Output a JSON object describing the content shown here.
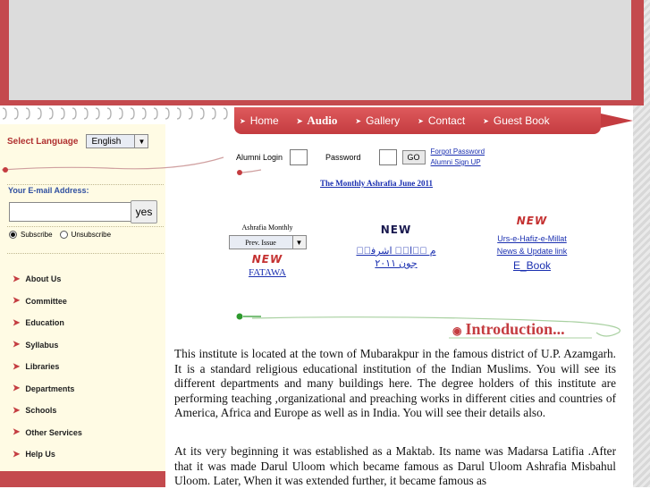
{
  "nav": {
    "items": [
      {
        "label": "Home",
        "bold": false
      },
      {
        "label": "Audio",
        "bold": true
      },
      {
        "label": "Gallery",
        "bold": false
      },
      {
        "label": "Contact",
        "bold": false
      },
      {
        "label": "Guest Book",
        "bold": false
      }
    ]
  },
  "language": {
    "label": "Select Language",
    "selected": "English"
  },
  "alumni": {
    "login_label": "Alumni Login",
    "password_label": "Password",
    "go_label": "GO",
    "forgot_password": "Forgot Password",
    "signup": "Alumni Sign UP"
  },
  "monthly_link": "The Monthly Ashrafia June 2011",
  "email": {
    "label": "Your E-mail Address:",
    "yes_label": "yes",
    "subscribe": "Subscribe",
    "unsubscribe": "Unsubscribe"
  },
  "menu": {
    "items": [
      "About Us",
      "Committee",
      "Education",
      "Syllabus",
      "Libraries",
      "Departments",
      "Schools",
      "Other Services",
      "Help Us"
    ]
  },
  "ashrafia": {
    "title": "Ashrafia Monthly",
    "select_value": "Prev. Issue",
    "new_badge": "NEW",
    "fatawa": "FATAWA"
  },
  "urdu": {
    "new_badge": "NEW",
    "line1": "م ٰ⃞ام⃞ اشرفی⃞",
    "line2": "جون ۲۰۱۱"
  },
  "urs": {
    "new_badge": "NEW",
    "line1": "Urs-e-Hafiz-e-Millat",
    "line2": "News & Update link",
    "ebook": "E_Book"
  },
  "intro": {
    "title": "Introduction...",
    "paragraph1": "This institute is located at the town of Mubarakpur in the famous district of U.P. Azamgarh. It is a standard religious educational institution of the  Indian Muslims. You will see its different departments and many buildings here. The degree holders of this institute are performing teaching ,organizational and preaching works in different cities and countries of America, Africa and Europe as well as in India. You will see their details also.",
    "paragraph2": "At its very beginning it was established as a Maktab. Its name was Madarsa Latifia .After that it was made Darul Uloom which became famous as Darul Uloom Ashrafia Misbahul Uloom. Later, When it was extended further, it became famous as"
  },
  "colors": {
    "brand_red": "#c44a4e",
    "link_blue": "#1a2fb0",
    "sidebar_bg": "#fffbe4"
  }
}
